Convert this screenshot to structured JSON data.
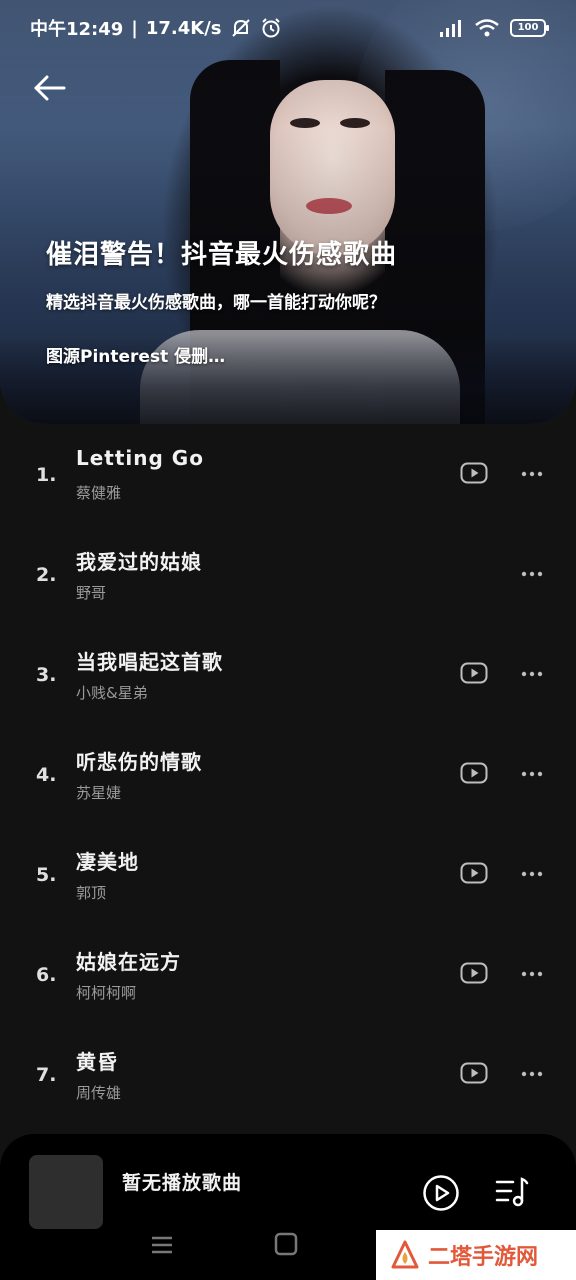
{
  "status_bar": {
    "time": "中午12:49",
    "separator": "|",
    "speed": "17.4K/s",
    "battery": "100"
  },
  "playlist": {
    "title": "催泪警告！抖音最火伤感歌曲",
    "description": "精选抖音最火伤感歌曲，哪一首能打动你呢？",
    "credit": "图源Pinterest 侵删…"
  },
  "songs": [
    {
      "num": "1.",
      "name": "Letting Go",
      "artist": "蔡健雅",
      "has_mv": true
    },
    {
      "num": "2.",
      "name": "我爱过的姑娘",
      "artist": "野哥",
      "has_mv": false
    },
    {
      "num": "3.",
      "name": "当我唱起这首歌",
      "artist": "小贱&星弟",
      "has_mv": true
    },
    {
      "num": "4.",
      "name": "听悲伤的情歌",
      "artist": "苏星婕",
      "has_mv": true
    },
    {
      "num": "5.",
      "name": "凄美地",
      "artist": "郭顶",
      "has_mv": true
    },
    {
      "num": "6.",
      "name": "姑娘在远方",
      "artist": "柯柯柯啊",
      "has_mv": true
    },
    {
      "num": "7.",
      "name": "黄昏",
      "artist": "周传雄",
      "has_mv": true
    }
  ],
  "player": {
    "now_playing": "暂无播放歌曲"
  },
  "watermark": {
    "text": "二塔手游网"
  },
  "icons": {
    "back": "arrow-left-icon",
    "mv": "video-play-icon",
    "more": "more-dots-icon",
    "play": "play-circle-icon",
    "queue": "playlist-icon"
  },
  "colors": {
    "background": "#121212",
    "player": "#000000",
    "watermark": "#e2593a"
  }
}
